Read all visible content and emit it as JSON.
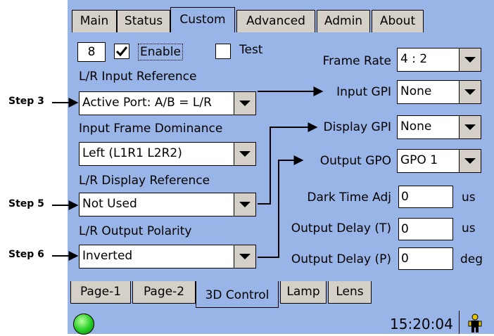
{
  "tabs": [
    "Main",
    "Status",
    "Custom",
    "Advanced",
    "Admin",
    "About"
  ],
  "channel_number": "8",
  "enable_label": "Enable",
  "test_label": "Test",
  "left": {
    "lr_input_reference": {
      "label": "L/R Input Reference",
      "value": "Active Port: A/B = L/R"
    },
    "input_frame_dominance": {
      "label": "Input Frame Dominance",
      "value": "Left (L1R1 L2R2)"
    },
    "lr_display_reference": {
      "label": "L/R Display Reference",
      "value": "Not Used"
    },
    "lr_output_polarity": {
      "label": "L/R Output Polarity",
      "value": "Inverted"
    }
  },
  "right": {
    "frame_rate": {
      "label": "Frame Rate",
      "value": "4 : 2"
    },
    "input_gpi": {
      "label": "Input GPI",
      "value": "None"
    },
    "display_gpi": {
      "label": "Display GPI",
      "value": "None"
    },
    "output_gpo": {
      "label": "Output GPO",
      "value": "GPO 1"
    },
    "dark_time_adj": {
      "label": "Dark Time Adj",
      "value": "0",
      "unit": "us"
    },
    "output_delay_t": {
      "label": "Output Delay (T)",
      "value": "0",
      "unit": "us"
    },
    "output_delay_p": {
      "label": "Output Delay (P)",
      "value": "0",
      "unit": "deg"
    }
  },
  "steps": [
    "Step 3",
    "Step 5",
    "Step 6"
  ],
  "bottom_tabs": [
    "Page-1",
    "Page-2",
    "3D Control",
    "Lamp",
    "Lens"
  ],
  "status": {
    "time": "15:20:04",
    "led_color": "#22cc22"
  },
  "colors": {
    "panel": "#99b4e6",
    "tab": "#d4d0c8"
  }
}
